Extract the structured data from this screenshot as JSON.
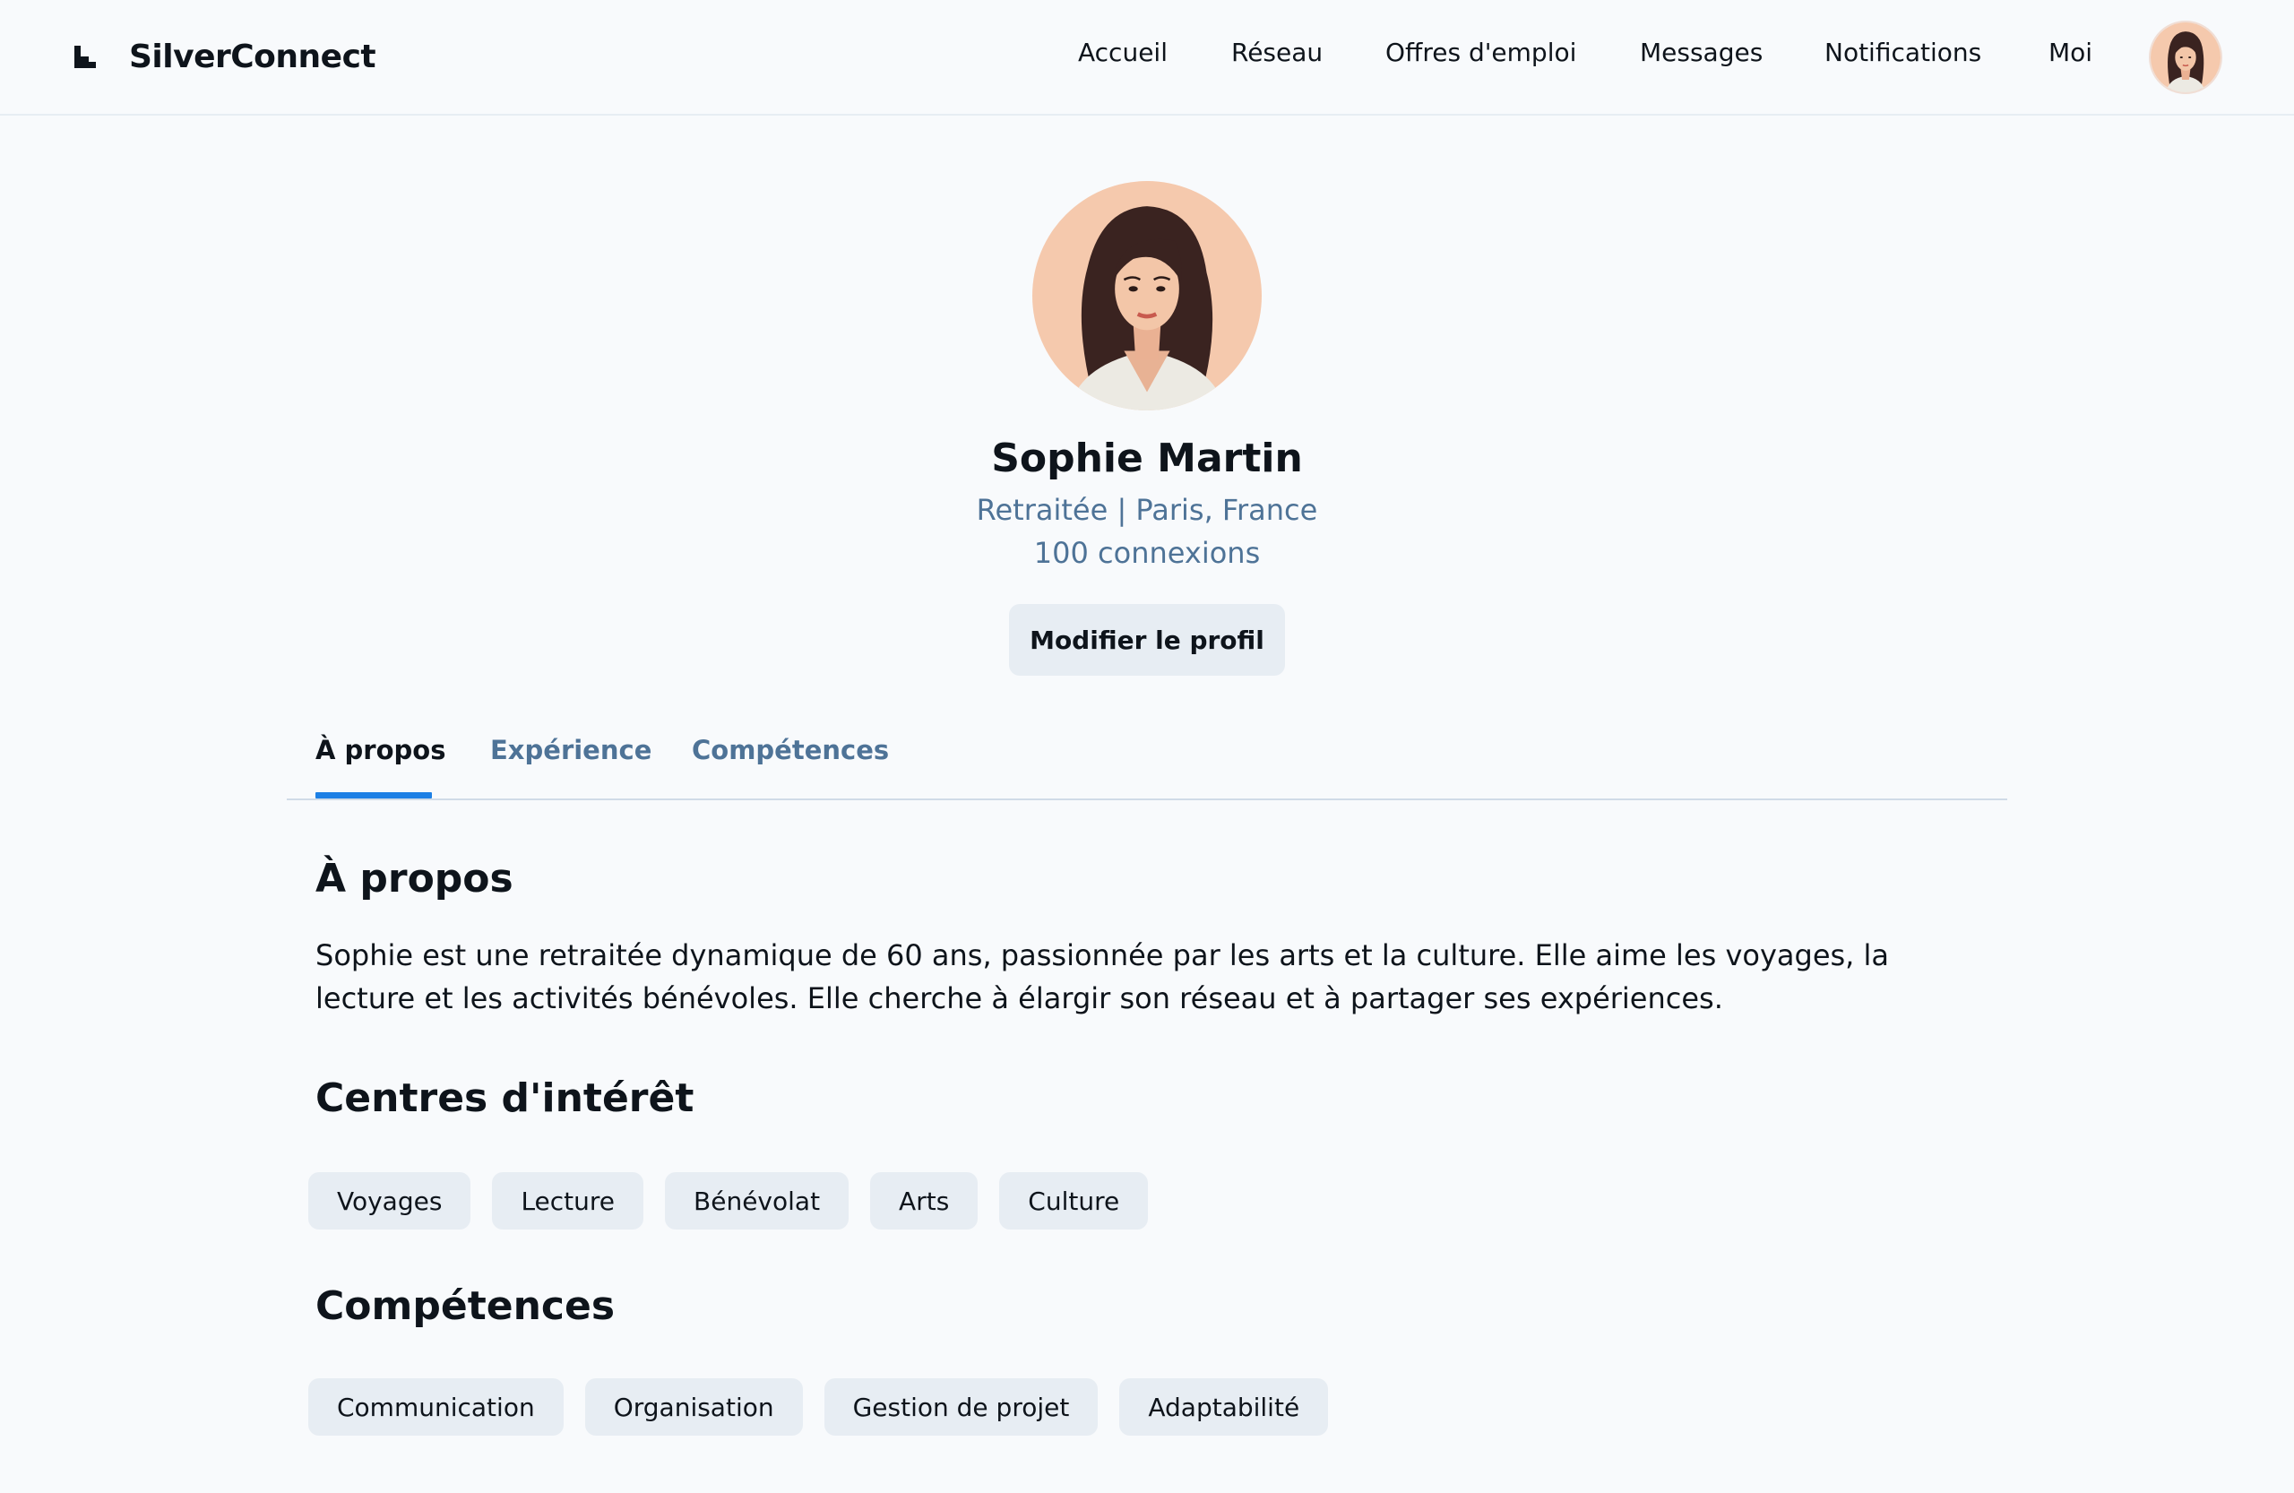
{
  "header": {
    "brand": "SilverConnect",
    "nav": [
      "Accueil",
      "Réseau",
      "Offres d'emploi",
      "Messages",
      "Notifications",
      "Moi"
    ]
  },
  "profile": {
    "name": "Sophie Martin",
    "headline": "Retraitée | Paris, France",
    "connections": "100 connexions",
    "edit_button": "Modifier le profil"
  },
  "tabs": [
    {
      "label": "À propos",
      "active": true
    },
    {
      "label": "Expérience",
      "active": false
    },
    {
      "label": "Compétences",
      "active": false
    }
  ],
  "about": {
    "title": "À propos",
    "text": "Sophie est une retraitée dynamique de 60 ans, passionnée par les arts et la culture. Elle aime les voyages, la lecture et les activités bénévoles. Elle cherche à élargir son réseau et à partager ses expériences."
  },
  "interests": {
    "title": "Centres d'intérêt",
    "items": [
      "Voyages",
      "Lecture",
      "Bénévolat",
      "Arts",
      "Culture"
    ]
  },
  "skills": {
    "title": "Compétences",
    "items": [
      "Communication",
      "Organisation",
      "Gestion de projet",
      "Adaptabilité"
    ]
  },
  "colors": {
    "background": "#f8fafc",
    "text": "#0e141b",
    "muted": "#4e7397",
    "chip": "#e7edf3",
    "accent": "#1d80e5",
    "avatar_bg": "#f5c9ad"
  },
  "icons": {
    "logo": "stair-logo-icon",
    "avatar": "user-avatar"
  }
}
